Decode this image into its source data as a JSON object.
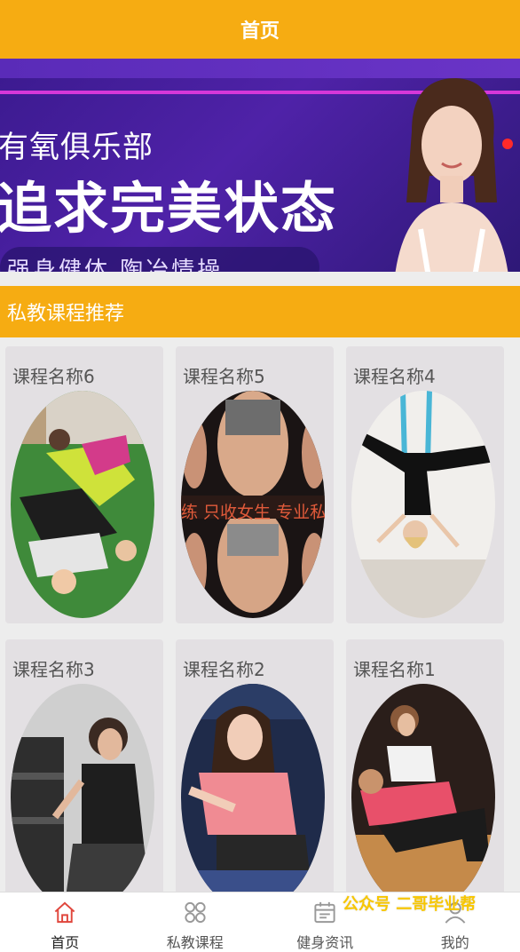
{
  "header": {
    "title": "首页"
  },
  "banner": {
    "line1": "有氧俱乐部",
    "line2": "追求完美状态",
    "line3": "强身健体  陶冶情操"
  },
  "section": {
    "title": "私教课程推荐"
  },
  "courses": [
    {
      "name": "课程名称6"
    },
    {
      "name": "课程名称5"
    },
    {
      "name": "课程名称4"
    },
    {
      "name": "课程名称3"
    },
    {
      "name": "课程名称2"
    },
    {
      "name": "课程名称1"
    }
  ],
  "course5_overlay": "练 只收女生 专业私教",
  "tabbar": {
    "items": [
      {
        "label": "首页",
        "icon": "home-icon"
      },
      {
        "label": "私教课程",
        "icon": "grid-icon"
      },
      {
        "label": "健身资讯",
        "icon": "calendar-icon"
      },
      {
        "label": "我的",
        "icon": "user-icon"
      }
    ]
  },
  "watermark": "公众号  二哥毕业帮",
  "colors": {
    "accent": "#f6ac12",
    "banner": "#4f22a8",
    "active_tab": "#e0463c"
  }
}
